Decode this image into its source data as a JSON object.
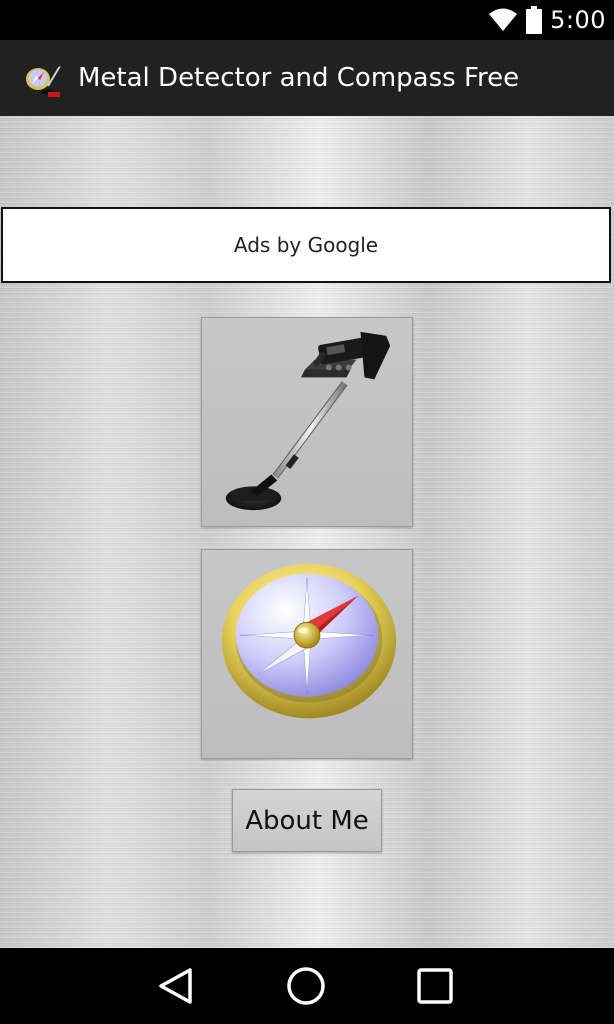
{
  "status_bar": {
    "time": "5:00"
  },
  "app_bar": {
    "title": "Metal Detector and Compass Free",
    "icon": "metal-detector-compass-app-icon"
  },
  "ad": {
    "text": "Ads by Google"
  },
  "buttons": {
    "detector_icon": "metal-detector-icon",
    "compass_icon": "compass-icon",
    "about_label": "About Me"
  },
  "nav": {
    "back": "back-icon",
    "home": "home-icon",
    "recents": "recents-icon"
  }
}
